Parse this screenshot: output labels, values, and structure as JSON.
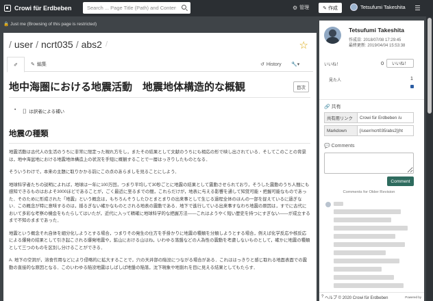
{
  "navbar": {
    "brand": "Crowi für Erdbeben",
    "search_placeholder": "Search ... Page Title (Path) and Content",
    "admin_label": "管理",
    "create_label": "作成",
    "user_name": "Tetsufumi Takeshita"
  },
  "restriction": {
    "text": "Just me (Browsing of this page is restricted)"
  },
  "page": {
    "path": [
      "/",
      "user",
      "/",
      "ncrt035",
      "/",
      "abs2",
      "/"
    ],
    "tabs": {
      "edit": "編集",
      "history": "History"
    },
    "title": "地中海圏における地震活動　地震地体構造的な概観",
    "toc_label": "目次",
    "bullet": "［］は訳者による補い",
    "section_title": "地震の種類",
    "paragraphs": [
      "地震活動は古代人の生活のうちに非常に限定った現れ方をし，またその結果として文献のうちにも相応の形で映し出されている．そしてこのことの背景は，地中海盆地における地震地体構造上の状況を手短に概観することで一層はっきりしたものとなる．",
      "そういうわけで，本来の主題に取りかかる前にこの点のあらましを見ることにしよう．",
      "地球科学者たちの説明によれば，地球は一年に100万回，つまり平均して30秒ごとに地震の結果として震動させられており，そうした震動のうち人間にも感知できるものはおよそ3000ほどであることが，ごく最近に至るまでの間，これらだけが，地表に与える影響を通して知覚可能・把握可能なものであった．そのために形成された「地震」という概念は，もちろんそうしたひとまとまりの出来事として生じる過程全体のほんの一部を捉えているに過ぎない．この概念が特に意味するのは，揺るぎない確かなものとされる地表の震動である．地下で進行している出来事すなわち地震の原因は，すでに古代において多彩な考察の機会をもたらしてはいたが，近代に入って精確に地球科学的な把握方法――これはようやく短い歴史を持つにすぎない――が成立するまで不知のままであった．",
      "地震という概念それ自体を細分化しようとする場合，つまりその発生の仕方を手掛かりに地震の種類を分類しようとする場合，例えば化学反応や核反応による爆発の結果として引き起こされる爆発地震や，鉱山における山はね，いわゆる落盤などの人為性の震動を考慮しないものとして，確かに地震の種類として三つのものを区別し分けることができる．",
      "A. 地下の空洞が，溶食作用などにより侵略的に拡大することで，穴の天井部の陥没につながる場合がある．これははっきりと感じ取れる地面表面での震動の直接的な原因となる．このいわゆる陥没地震はしばしば地盤の陥落，沈下現象や地割れを目に見える結果としてもたらす．"
    ]
  },
  "sidebar": {
    "user_name": "Tetsufumi Takeshita",
    "created": "作成日: 2018/07/08 17:29:45",
    "updated": "最終更新: 2019/04/04 15:53:38",
    "like_label": "いいね！",
    "like_count": "0",
    "like_button": "いいね！",
    "seen_label": "見た人",
    "seen_count": "1",
    "share_title": "共有",
    "share_rows": [
      {
        "label": "共有用リンク",
        "value": "Crowi für Erdbeben /u"
      },
      {
        "label": "Markdown",
        "value": "[/user/ncrt035/abs2](ht"
      }
    ],
    "comments_title": "Comments",
    "comment_button": "Comment",
    "old_revision": "Comments for Older Revision",
    "footer": "ヘルプ © 2020 Crowi für Erdbeben",
    "powered_by": "Powered by"
  }
}
